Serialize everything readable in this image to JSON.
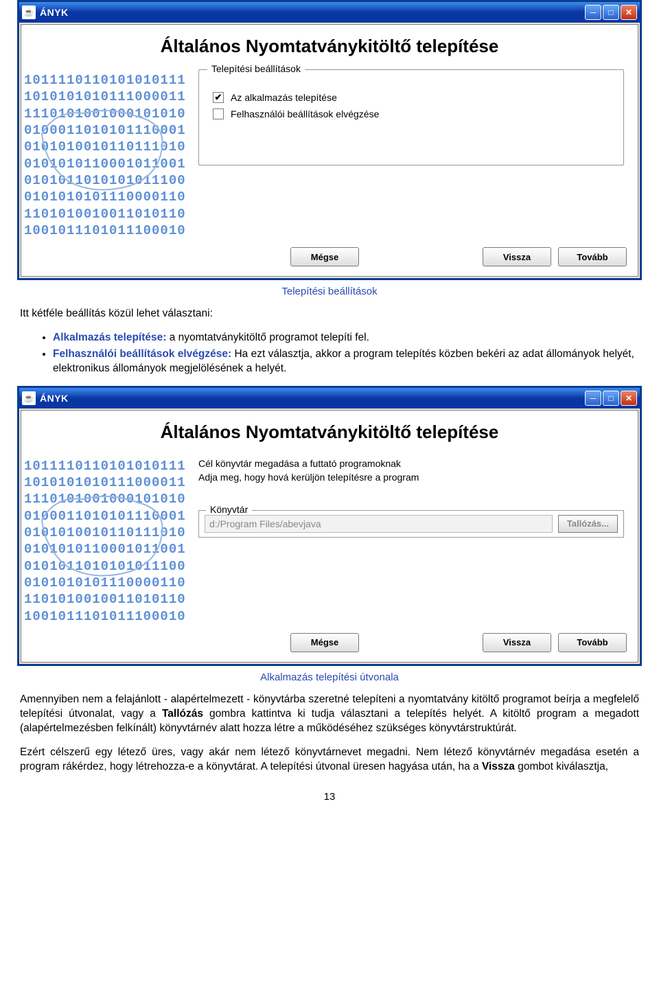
{
  "window1": {
    "app_title": "ÁNYK",
    "heading": "Általános Nyomtatványkitöltő telepítése",
    "fieldset_legend": "Telepítési beállítások",
    "cb1_label": "Az alkalmazás telepítése",
    "cb2_label": "Felhasználói beállítások elvégzése",
    "btn_cancel": "Mégse",
    "btn_back": "Vissza",
    "btn_next": "Tovább"
  },
  "caption1": "Telepítési beállítások",
  "doc1": {
    "intro": "Itt kétféle beállítás közül lehet választani:",
    "li1_label": "Alkalmazás telepítése:",
    "li1_rest": " a nyomtatványkitöltő programot telepíti fel.",
    "li2_label": "Felhasználói beállítások elvégzése:",
    "li2_rest": " Ha ezt választja, akkor a program telepítés közben bekéri az adat állományok helyét, elektronikus állományok megjelölésének a helyét."
  },
  "window2": {
    "app_title": "ÁNYK",
    "heading": "Általános Nyomtatványkitöltő telepítése",
    "line1": "Cél könyvtár megadása a futtató programoknak",
    "line2": "Adja meg, hogy hová kerüljön telepítésre a program",
    "dir_legend": "Könyvtár",
    "dir_value": "d:/Program Files/abevjava",
    "browse_label": "Tallózás...",
    "btn_cancel": "Mégse",
    "btn_back": "Vissza",
    "btn_next": "Tovább"
  },
  "caption2": "Alkalmazás telepítési útvonala",
  "doc2": {
    "p1_a": "Amennyiben nem a felajánlott - alapértelmezett - könyvtárba szeretné telepíteni a nyomtatvány kitöltő programot beírja a megfelelő telepítési útvonalat, vagy a ",
    "p1_bold1": "Tallózás",
    "p1_b": " gombra kattintva ki tudja választani a telepítés helyét. A kitöltő program a megadott (alapértelmezésben felkínált) könyvtárnév alatt hozza létre a működéséhez szükséges könyvtárstruktúrát.",
    "p2_a": "Ezért célszerű egy létező üres, vagy akár nem létező könyvtárnevet megadni. Nem létező könyvtárnév megadása esetén a program rákérdez, hogy létrehozza-e a könyvtárat. A telepítési útvonal üresen hagyása után, ha a ",
    "p2_bold1": "Vissza",
    "p2_b": " gombot kiválasztja,"
  },
  "page_number": "13",
  "sidebar_binary": "1011110110101010111\n1010101010111000011\n1110101001000101010\n0100011010101110001\n0101010010110111010\n0101010110001011001\n0101011010101011100\n0101010101110000110\n1101010010011010110\n1001011101011100010"
}
